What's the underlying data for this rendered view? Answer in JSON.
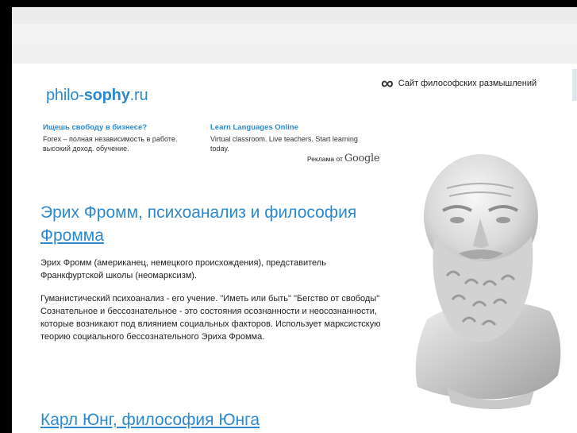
{
  "header": {
    "logo_part1": "philo-",
    "logo_part2": "sophy",
    "logo_part3": ".ru",
    "tagline": "Сайт философских размышлений",
    "tagline_icon": "infinity-icon"
  },
  "ads": [
    {
      "title": "Ищешь свободу в бизнесе?",
      "text": "Forex – полная независимость в работе. высокий доход. обучение."
    },
    {
      "title": "Learn Languages Online",
      "text": "Virtual classroom. Live teachers. Start learning today."
    }
  ],
  "ad_credit": {
    "label": "Реклама от",
    "brand": "Google"
  },
  "articles": [
    {
      "title_line1": "Эрих Фромм, психоанализ и философия",
      "title_line2": "Фромма",
      "paragraphs": [
        "Эрих Фромм (американец, немецкого происхождения), представитель Франкфуртской школы (неомарксизм).",
        "Гуманистический психоанализ - его учение. \"Иметь или быть\" \"Бегство от свободы\"",
        "Сознательное и бессознательное - это состояния осознанности и неосознанности, которые возникают под влиянием социальных факторов. Использует марксистскую теорию социального бессознательного Эриха Фромма."
      ]
    },
    {
      "title": "Карл Юнг, философия Юнга"
    }
  ],
  "colors": {
    "link": "#2d89cf",
    "frame": "#000000",
    "background": "#ffffff"
  }
}
